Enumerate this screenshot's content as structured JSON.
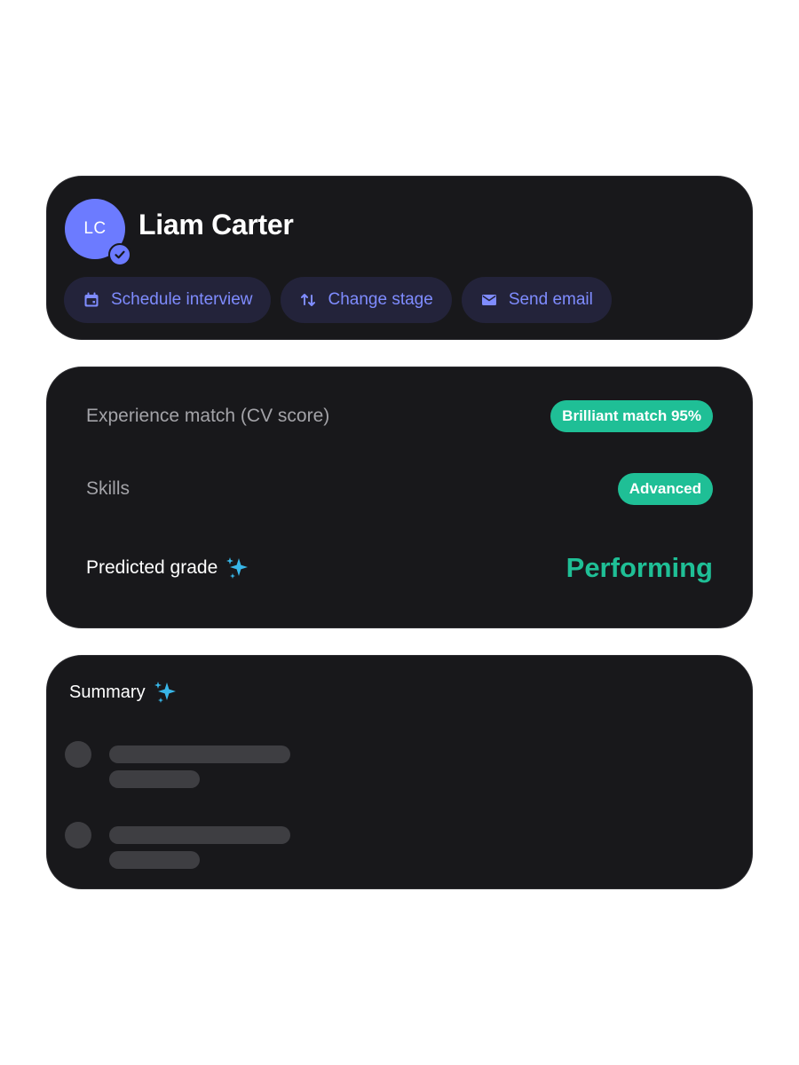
{
  "profile": {
    "avatar_initials": "LC",
    "name": "Liam Carter",
    "verified_icon": "check-circle-icon",
    "actions": [
      {
        "label": "Schedule interview",
        "icon": "calendar-icon"
      },
      {
        "label": "Change stage",
        "icon": "swap-vertical-icon"
      },
      {
        "label": "Send email",
        "icon": "mail-icon"
      }
    ]
  },
  "metrics": {
    "experience": {
      "label": "Experience match (CV score)",
      "badge": "Brilliant match 95%"
    },
    "skills": {
      "label": "Skills",
      "badge": "Advanced"
    },
    "predicted": {
      "label": "Predicted grade",
      "icon": "sparkles-icon",
      "value": "Performing"
    }
  },
  "summary": {
    "title": "Summary",
    "icon": "sparkles-icon",
    "loading_items": 2
  },
  "colors": {
    "card_bg": "#18181b",
    "accent": "#6c7bff",
    "action_text": "#7f8cff",
    "success": "#1fbf96",
    "sparkle": "#38b6e8"
  }
}
